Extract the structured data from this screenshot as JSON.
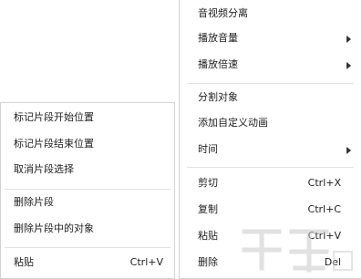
{
  "right_menu": {
    "items": [
      {
        "label": "音视频分离"
      },
      {
        "label": "播放音量",
        "arrow": "chevron-right-icon"
      },
      {
        "label": "播放倍速",
        "arrow": "chevron-right-icon"
      },
      {
        "label": "分割对象"
      },
      {
        "label": "添加自定义动画"
      },
      {
        "label": "时间",
        "arrow": "chevron-right-icon"
      },
      {
        "label": "剪切",
        "shortcut": "Ctrl+X"
      },
      {
        "label": "复制",
        "shortcut": "Ctrl+C"
      },
      {
        "label": "粘贴",
        "shortcut": "Ctrl+V"
      },
      {
        "label": "删除",
        "shortcut": "Del"
      }
    ]
  },
  "left_menu": {
    "items": [
      {
        "label": "标记片段开始位置"
      },
      {
        "label": "标记片段结束位置"
      },
      {
        "label": "取消片段选择"
      },
      {
        "label": "删除片段"
      },
      {
        "label": "删除片段中的对象"
      },
      {
        "label": "粘贴",
        "shortcut": "Ctrl+V"
      }
    ]
  },
  "colors": {
    "menu_border": "#d3d3d3",
    "separator": "#e2e2e2",
    "text": "#222222"
  }
}
